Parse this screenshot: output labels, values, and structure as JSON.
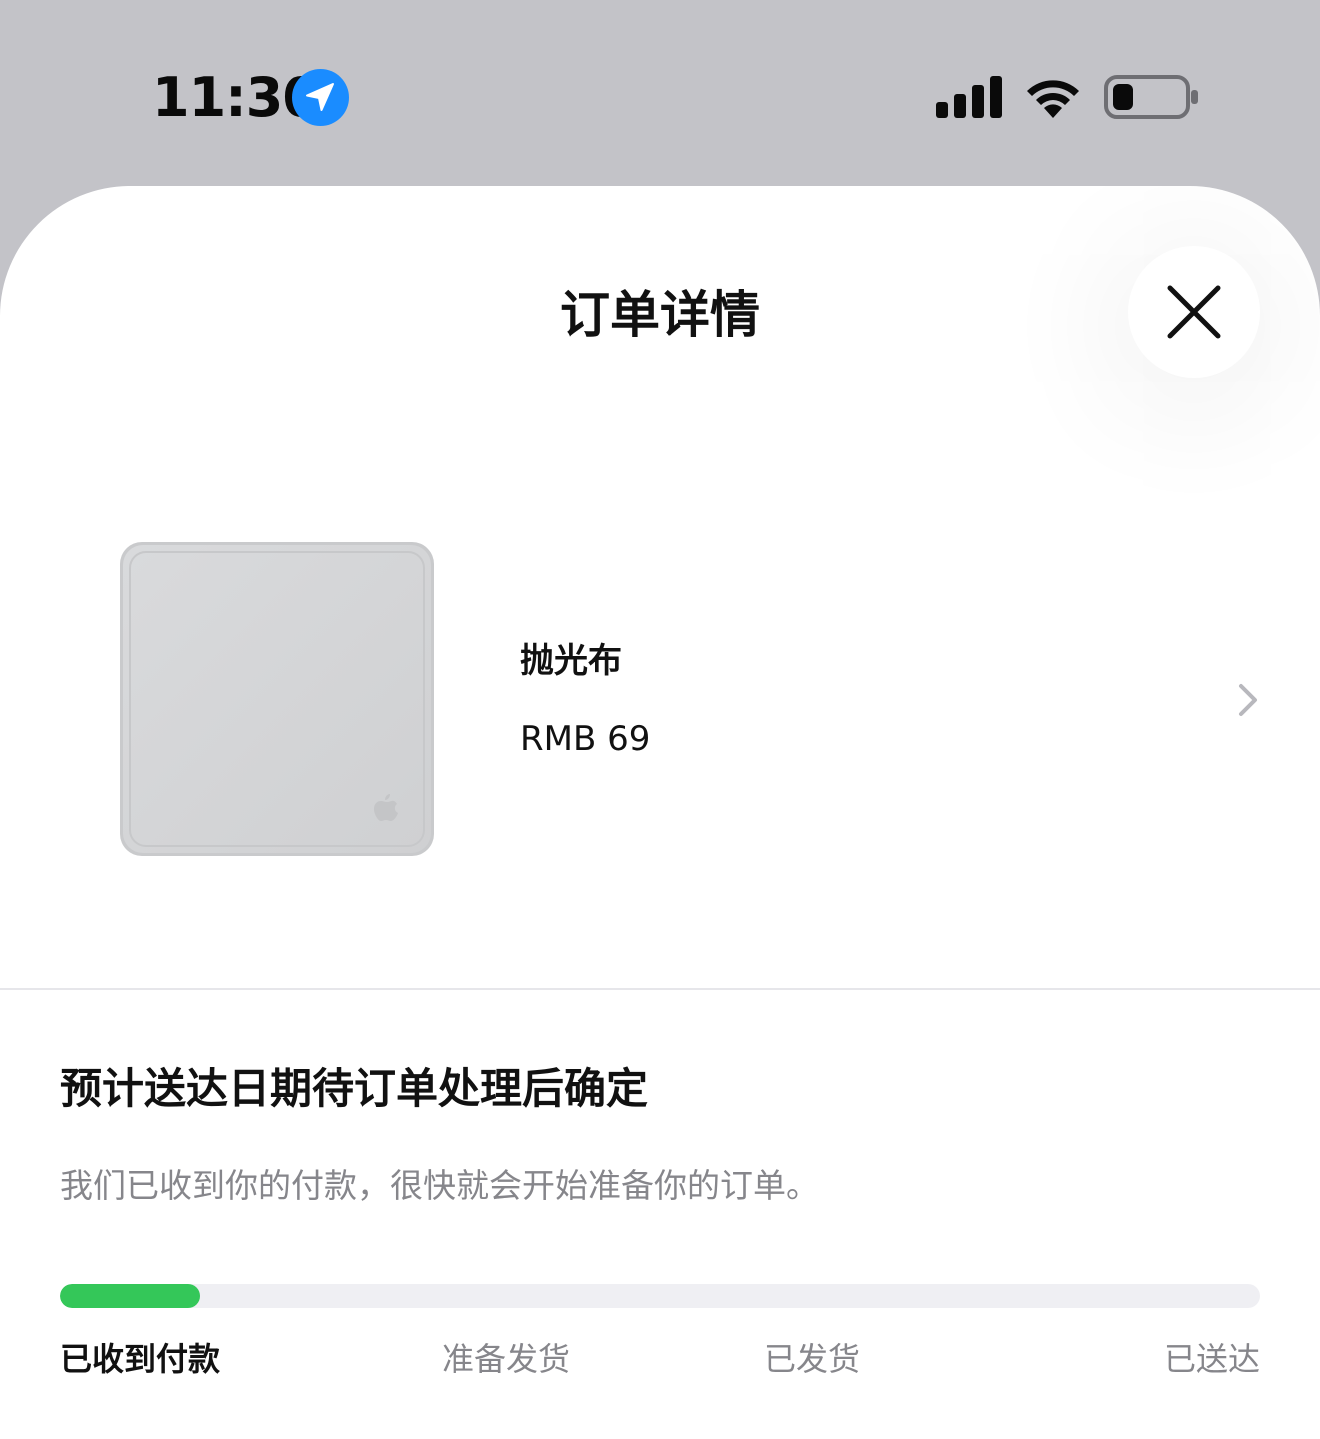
{
  "status_bar": {
    "time": "11:30",
    "icons": [
      "location-arrow-icon",
      "cellular-signal-icon",
      "wifi-icon",
      "battery-low-icon"
    ],
    "location_color": "#1a8cff"
  },
  "sheet": {
    "title": "订单详情",
    "close_icon": "close-icon"
  },
  "product": {
    "name": "抛光布",
    "price": "RMB 69",
    "image": "polishing-cloth-image",
    "chevron_icon": "chevron-right-icon"
  },
  "delivery": {
    "title": "预计送达日期待订单处理后确定",
    "description": "我们已收到你的付款，很快就会开始准备你的订单。",
    "progress_fraction": 0.117,
    "progress_color": "#34c759",
    "steps": [
      {
        "label": "已收到付款",
        "active": true
      },
      {
        "label": "准备发货",
        "active": false
      },
      {
        "label": "已发货",
        "active": false
      },
      {
        "label": "已送达",
        "active": false
      }
    ]
  }
}
